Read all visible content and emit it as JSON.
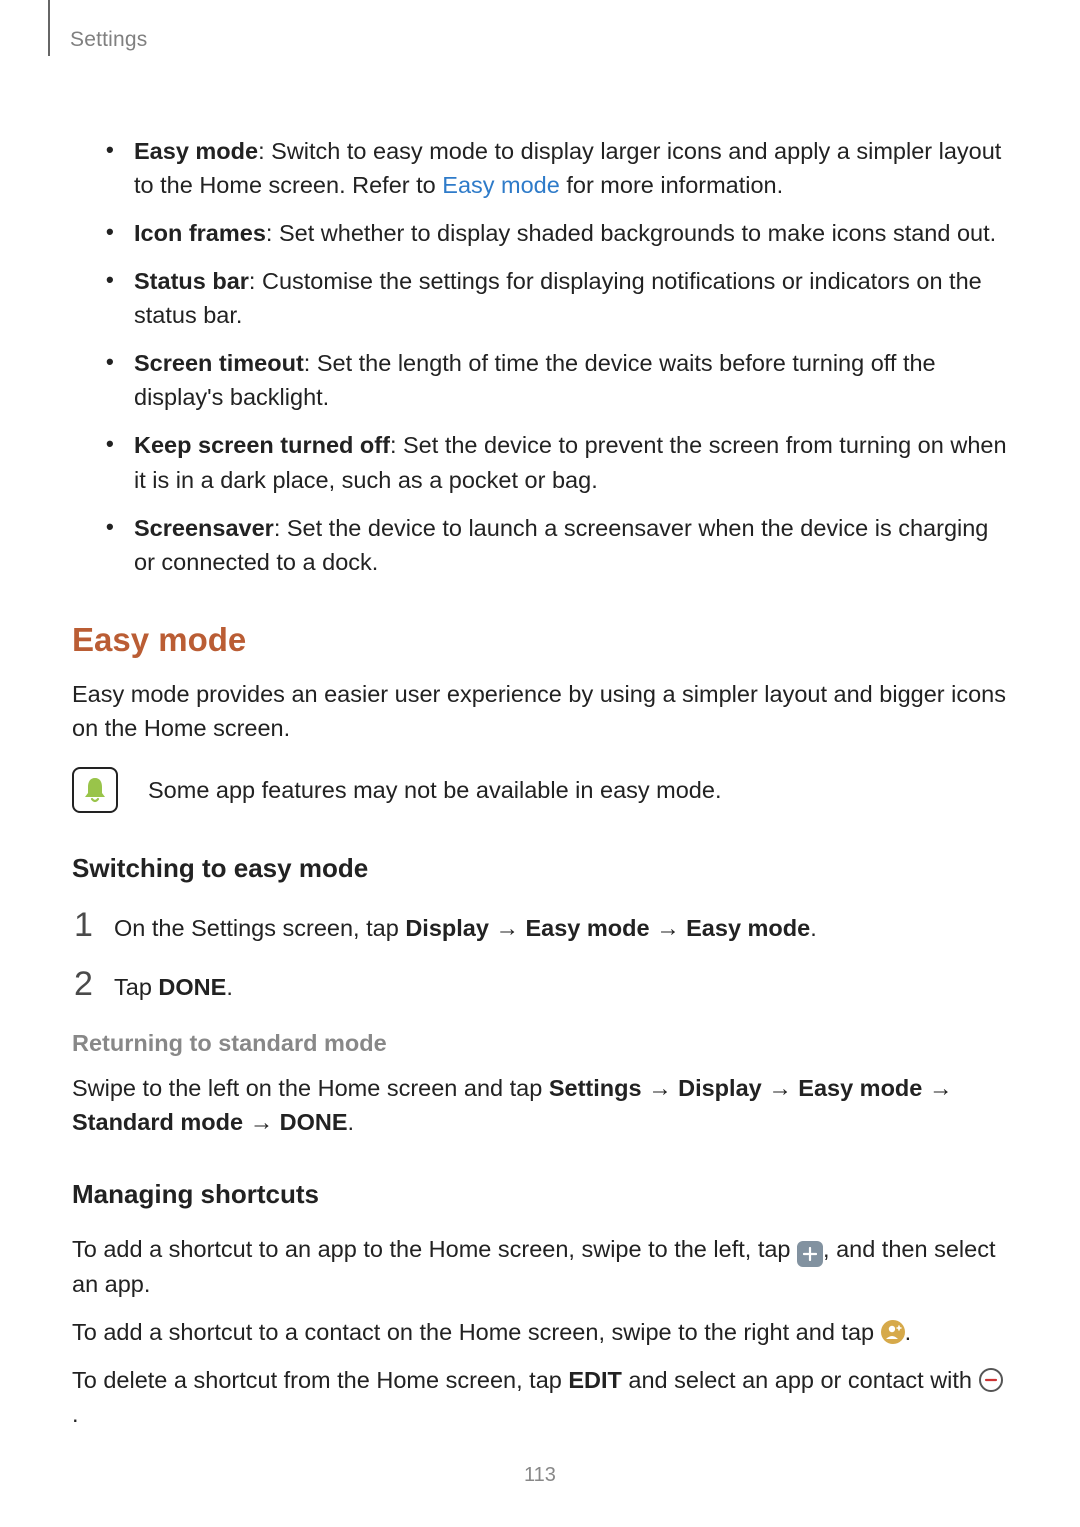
{
  "header": {
    "label": "Settings"
  },
  "bullets": [
    {
      "term": "Easy mode",
      "text": ": Switch to easy mode to display larger icons and apply a simpler layout to the Home screen. Refer to ",
      "link": "Easy mode",
      "after": " for more information."
    },
    {
      "term": "Icon frames",
      "text": ": Set whether to display shaded backgrounds to make icons stand out."
    },
    {
      "term": "Status bar",
      "text": ": Customise the settings for displaying notifications or indicators on the status bar."
    },
    {
      "term": "Screen timeout",
      "text": ": Set the length of time the device waits before turning off the display's backlight."
    },
    {
      "term": "Keep screen turned off",
      "text": ": Set the device to prevent the screen from turning on when it is in a dark place, such as a pocket or bag."
    },
    {
      "term": "Screensaver",
      "text": ": Set the device to launch a screensaver when the device is charging or connected to a dock."
    }
  ],
  "section": {
    "title": "Easy mode",
    "intro": "Easy mode provides an easier user experience by using a simpler layout and bigger icons on the Home screen.",
    "note": "Some app features may not be available in easy mode."
  },
  "switching": {
    "heading": "Switching to easy mode",
    "step1_pre": "On the Settings screen, tap ",
    "step1_b1": "Display",
    "step1_b2": "Easy mode",
    "step1_b3": "Easy mode",
    "step2_pre": "Tap ",
    "step2_b1": "DONE",
    "step_nums": {
      "one": "1",
      "two": "2"
    },
    "arrow": " → ",
    "period": "."
  },
  "returning": {
    "heading": "Returning to standard mode",
    "pre": "Swipe to the left on the Home screen and tap ",
    "b1": "Settings",
    "b2": "Display",
    "b3": "Easy mode",
    "b4": "Standard mode",
    "b5": "DONE",
    "arrow": " → ",
    "period": "."
  },
  "managing": {
    "heading": "Managing shortcuts",
    "line1_pre": "To add a shortcut to an app to the Home screen, swipe to the left, tap ",
    "line1_post": ", and then select an app.",
    "line2_pre": "To add a shortcut to a contact on the Home screen, swipe to the right and tap ",
    "line2_post": ".",
    "line3_pre": "To delete a shortcut from the Home screen, tap ",
    "line3_b1": "EDIT",
    "line3_mid": " and select an app or contact with ",
    "line3_post": "."
  },
  "page_number": "113"
}
